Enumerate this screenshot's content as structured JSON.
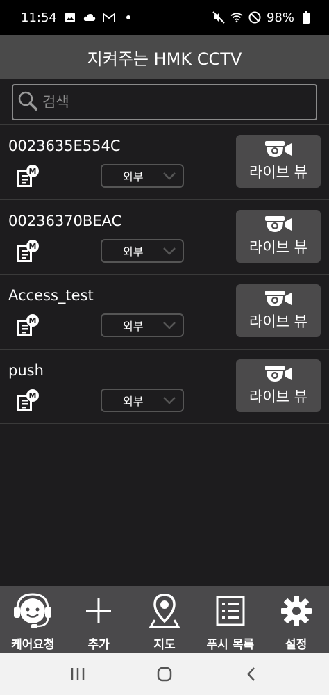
{
  "status_bar": {
    "time": "11:54",
    "battery": "98%",
    "left_icons": [
      "image-icon",
      "cloud-icon",
      "gmail-icon",
      "dot-icon"
    ],
    "right_icons": [
      "mute-icon",
      "wifi-icon",
      "do-not-disturb-icon",
      "battery-icon"
    ]
  },
  "header": {
    "title": "지켜주는 HMK CCTV"
  },
  "search": {
    "placeholder": "검색",
    "value": ""
  },
  "devices": [
    {
      "name": "0023635E554C",
      "network": "외부",
      "live_label": "라이브 뷰"
    },
    {
      "name": "00236370BEAC",
      "network": "외부",
      "live_label": "라이브 뷰"
    },
    {
      "name": "Access_test",
      "network": "외부",
      "live_label": "라이브 뷰"
    },
    {
      "name": "push",
      "network": "외부",
      "live_label": "라이브 뷰"
    }
  ],
  "bottom_nav": [
    {
      "label": "케어요청",
      "icon": "support-agent-icon"
    },
    {
      "label": "추가",
      "icon": "plus-icon"
    },
    {
      "label": "지도",
      "icon": "map-pin-icon"
    },
    {
      "label": "푸시 목록",
      "icon": "list-icon"
    },
    {
      "label": "설정",
      "icon": "gear-icon"
    }
  ],
  "system_nav": [
    "recents-icon",
    "home-icon",
    "back-icon"
  ],
  "colors": {
    "background": "#1d1c1e",
    "header": "#4a4a4a",
    "button": "#4b4a4b",
    "nav_bar": "#4a494b"
  }
}
